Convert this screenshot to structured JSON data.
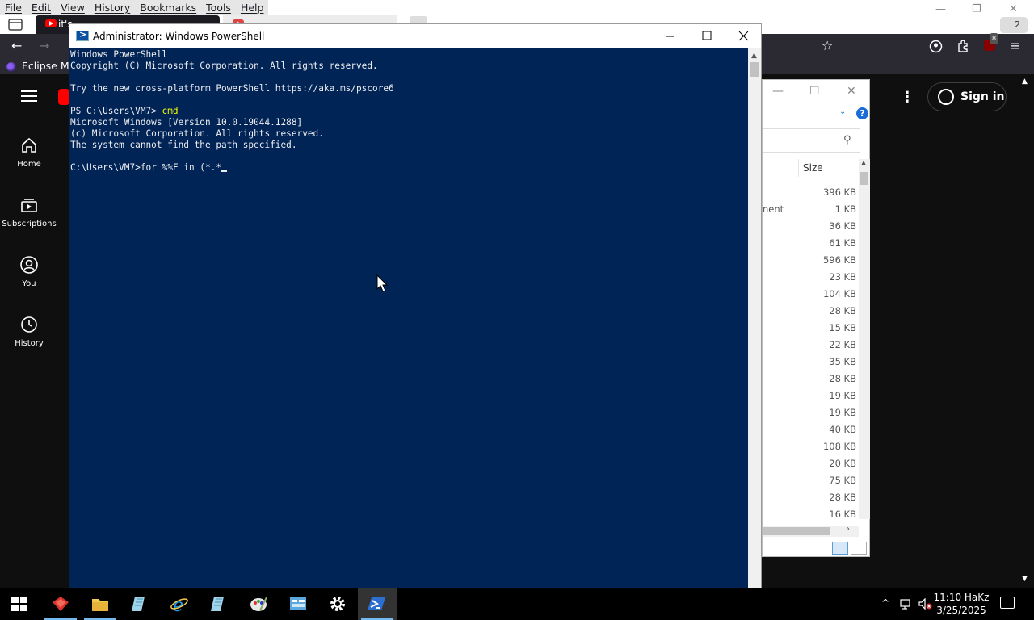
{
  "firefox": {
    "menu": [
      "File",
      "Edit",
      "View",
      "History",
      "Bookmarks",
      "Tools",
      "Help"
    ],
    "tabs": [
      {
        "label": "it's..."
      },
      {
        "label": "..."
      }
    ],
    "tab_count": "2",
    "extension_badge": "8",
    "bookmark": "Eclipse Ma..."
  },
  "youtube": {
    "nav": [
      {
        "label": "Home",
        "icon": "home-icon"
      },
      {
        "label": "Subscriptions",
        "icon": "subscriptions-icon"
      },
      {
        "label": "You",
        "icon": "you-icon"
      },
      {
        "label": "History",
        "icon": "history-icon"
      }
    ],
    "sign_in": "Sign in"
  },
  "explorer": {
    "size_header": "Size",
    "type_fragment": "nent",
    "sizes": [
      "396 KB",
      "1 KB",
      "36 KB",
      "61 KB",
      "596 KB",
      "23 KB",
      "104 KB",
      "28 KB",
      "15 KB",
      "22 KB",
      "35 KB",
      "28 KB",
      "19 KB",
      "19 KB",
      "40 KB",
      "108 KB",
      "20 KB",
      "75 KB",
      "28 KB",
      "16 KB"
    ]
  },
  "powershell": {
    "title": "Administrator: Windows PowerShell",
    "lines": [
      {
        "text": "Windows PowerShell",
        "kind": "out"
      },
      {
        "text": "Copyright (C) Microsoft Corporation. All rights reserved.",
        "kind": "out"
      },
      {
        "text": "",
        "kind": "out"
      },
      {
        "text": "Try the new cross-platform PowerShell https://aka.ms/pscore6",
        "kind": "out"
      },
      {
        "text": "",
        "kind": "out"
      },
      {
        "prompt": "PS C:\\Users\\VM7> ",
        "command": "cmd",
        "kind": "ps"
      },
      {
        "text": "Microsoft Windows [Version 10.0.19044.1288]",
        "kind": "out"
      },
      {
        "text": "(c) Microsoft Corporation. All rights reserved.",
        "kind": "out"
      },
      {
        "text": "The system cannot find the path specified.",
        "kind": "out"
      },
      {
        "text": "",
        "kind": "out"
      },
      {
        "text": "C:\\Users\\VM7>for %%F in (*.*",
        "kind": "input"
      }
    ]
  },
  "taskbar": {
    "apps": [
      "start",
      "app-red",
      "file-explorer",
      "notepad",
      "internet-explorer",
      "notepad-2",
      "paint",
      "control-panel",
      "settings",
      "powershell"
    ],
    "clock_time": "11:10 HaKz",
    "clock_date": "3/25/2025"
  },
  "colors": {
    "console_bg": "#012456",
    "console_fg": "#eeedf0",
    "command_yellow": "#ffff00",
    "youtube_bg": "#0f0f0f",
    "youtube_red": "#ff0000"
  }
}
